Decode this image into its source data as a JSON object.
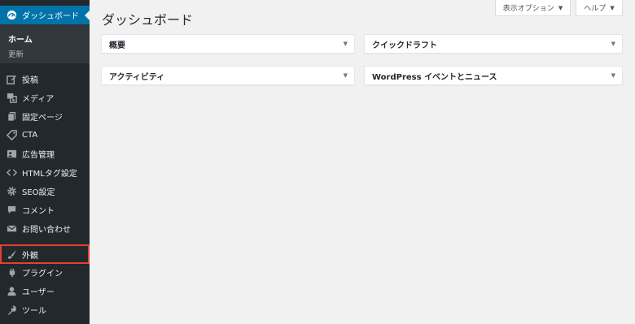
{
  "colors": {
    "sidebar_bg": "#23282d",
    "accent": "#0073aa",
    "submenu_bg": "#32373c",
    "highlight": "#e5412c",
    "page_bg": "#f1f1f1"
  },
  "sidebar": {
    "current": {
      "label": "ダッシュボード",
      "icon": "dashboard-icon"
    },
    "submenu": {
      "active": "ホーム",
      "sub": "更新"
    },
    "items": [
      {
        "label": "投稿",
        "icon": "post-icon"
      },
      {
        "label": "メディア",
        "icon": "media-icon"
      },
      {
        "label": "固定ページ",
        "icon": "page-icon"
      },
      {
        "label": "CTA",
        "icon": "tag-icon"
      },
      {
        "label": "広告管理",
        "icon": "ad-icon"
      },
      {
        "label": "HTMLタグ設定",
        "icon": "code-icon"
      },
      {
        "label": "SEO設定",
        "icon": "gear-icon"
      },
      {
        "label": "コメント",
        "icon": "comment-icon"
      },
      {
        "label": "お問い合わせ",
        "icon": "mail-icon"
      },
      {
        "label": "外観",
        "icon": "brush-icon"
      },
      {
        "label": "プラグイン",
        "icon": "plugin-icon"
      },
      {
        "label": "ユーザー",
        "icon": "user-icon"
      },
      {
        "label": "ツール",
        "icon": "wrench-icon"
      }
    ]
  },
  "header": {
    "title": "ダッシュボード",
    "screen_options": "表示オプション",
    "help": "ヘルプ",
    "caret": "▼"
  },
  "widgets": [
    {
      "title": "概要"
    },
    {
      "title": "クイックドラフト"
    },
    {
      "title": "アクティビティ"
    },
    {
      "title": "WordPress イベントとニュース"
    }
  ],
  "widget_toggle": "▼"
}
